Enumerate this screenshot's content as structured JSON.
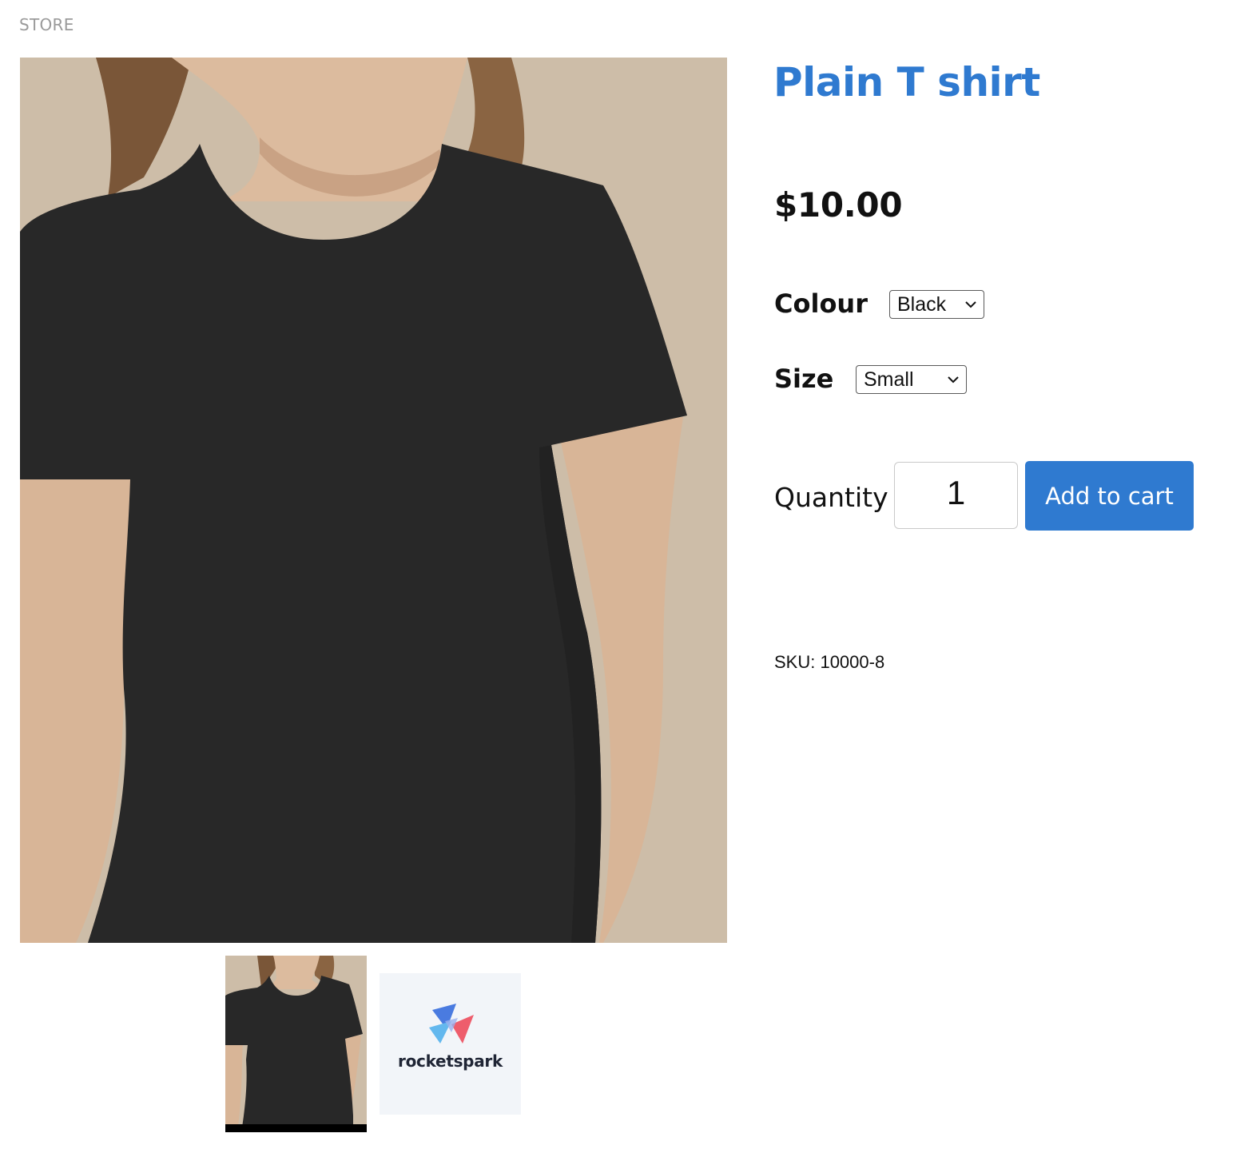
{
  "breadcrumb": {
    "label": "STORE"
  },
  "product": {
    "title": "Plain T shirt",
    "price": "$10.00",
    "sku": "SKU: 10000-8"
  },
  "options": {
    "colour": {
      "label": "Colour",
      "selected": "Black"
    },
    "size": {
      "label": "Size",
      "selected": "Small"
    }
  },
  "purchase": {
    "quantity_label": "Quantity",
    "quantity_value": "1",
    "add_to_cart_label": "Add to cart"
  },
  "gallery": {
    "thumbnails": [
      {
        "name": "product-photo-thumbnail",
        "active": true
      },
      {
        "name": "rocketspark-logo-thumbnail",
        "brand_text": "rocketspark",
        "active": false
      }
    ]
  },
  "colors": {
    "accent": "#2f7ad0",
    "backdrop": "#cdbda8",
    "shirt": "#282828",
    "breadcrumb": "#9a9a9a"
  }
}
